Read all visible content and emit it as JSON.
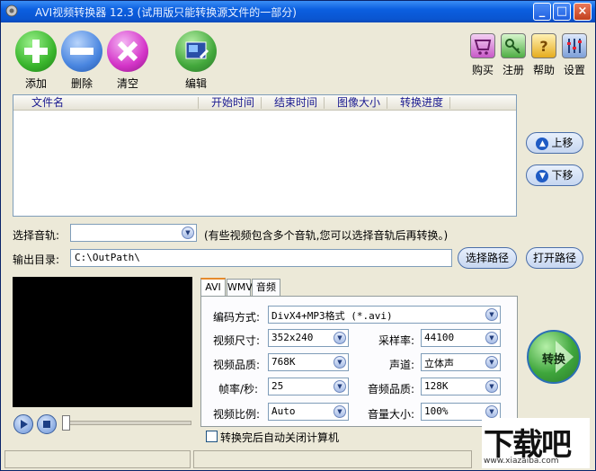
{
  "window": {
    "title": "AVI视频转换器 12.3 (试用版只能转换源文件的一部分)",
    "minimize": "_",
    "maximize": "□",
    "close": "×"
  },
  "toolbar": {
    "add": "添加",
    "delete": "删除",
    "clear": "清空",
    "edit": "编辑",
    "buy": "购买",
    "register": "注册",
    "help": "帮助",
    "settings": "设置"
  },
  "file_list": {
    "columns": [
      "文件名",
      "开始时间",
      "结束时间",
      "图像大小",
      "转换进度"
    ],
    "rows": []
  },
  "side_buttons": {
    "move_up": "上移",
    "move_down": "下移"
  },
  "audio_track": {
    "label": "选择音轨:",
    "value": "",
    "hint": "(有些视频包含多个音轨,您可以选择音轨后再转换。)"
  },
  "output": {
    "label": "输出目录:",
    "value": "C:\\OutPath\\",
    "select_button": "选择路径",
    "open_button": "打开路径"
  },
  "tabs": [
    "AVI",
    "WMV",
    "音频"
  ],
  "settings": {
    "codec_label": "编码方式:",
    "codec_value": "DivX4+MP3格式 (*.avi)",
    "size_label": "视频尺寸:",
    "size_value": "352x240",
    "quality_label": "视频品质:",
    "quality_value": "768K",
    "fps_label": "帧率/秒:",
    "fps_value": "25",
    "ratio_label": "视频比例:",
    "ratio_value": "Auto",
    "samplerate_label": "采样率:",
    "samplerate_value": "44100",
    "channel_label": "声道:",
    "channel_value": "立体声",
    "audioquality_label": "音频品质:",
    "audioquality_value": "128K",
    "volume_label": "音量大小:",
    "volume_value": "100%"
  },
  "convert_button": "转换",
  "shutdown_checkbox": {
    "label": "转换完后自动关闭计算机",
    "checked": false
  },
  "watermark": {
    "text": "下载吧",
    "url": "www.xiazaiba.com"
  }
}
